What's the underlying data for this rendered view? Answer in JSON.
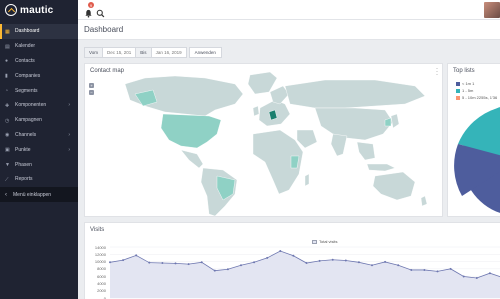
{
  "app": {
    "name": "mautic"
  },
  "header": {
    "notification_count": "9"
  },
  "sidebar": {
    "items": [
      {
        "label": "Dashboard",
        "icon": "dashboard-icon",
        "active": true
      },
      {
        "label": "Kalender",
        "icon": "calendar-icon"
      },
      {
        "label": "Contacts",
        "icon": "user-icon"
      },
      {
        "label": "Companies",
        "icon": "building-icon"
      },
      {
        "label": "Segments",
        "icon": "pie-chart-icon"
      },
      {
        "label": "Komponenten",
        "icon": "puzzle-icon",
        "has_children": true
      },
      {
        "label": "Kampagnen",
        "icon": "clock-icon"
      },
      {
        "label": "Channels",
        "icon": "rss-icon",
        "has_children": true
      },
      {
        "label": "Punkte",
        "icon": "calculator-icon",
        "has_children": true
      },
      {
        "label": "Phasen",
        "icon": "filter-icon"
      },
      {
        "label": "Reports",
        "icon": "line-chart-icon"
      }
    ],
    "collapse_label": "Menü einklappen"
  },
  "page": {
    "title": "Dashboard"
  },
  "date_filter": {
    "from_label": "Vom",
    "from_value": "Dec 15, 201",
    "to_label": "Bis",
    "to_value": "Jan 16, 2019",
    "apply_label": "Anwenden"
  },
  "contact_map": {
    "title": "Contact map",
    "zoom_in": "+",
    "zoom_out": "−",
    "colors": {
      "land": "#c8d8d8",
      "highlight_strong": "#41b9a3",
      "highlight_light": "#8fd1c5",
      "highlight_dark": "#1a7f6e"
    }
  },
  "top_lists": {
    "title": "Top lists",
    "legend": [
      {
        "label": "< 1m 1",
        "color": "#4e5d9d"
      },
      {
        "label": "1 - 5m",
        "color": "#35b4b9"
      },
      {
        "label": "5 - 10m 2255s, 1'36",
        "color": "#fd9572"
      }
    ]
  },
  "visits": {
    "title": "Visits",
    "legend": "Total visits",
    "y_ticks": [
      "14000",
      "12000",
      "10000",
      "8000",
      "6000",
      "4000",
      "2000",
      "0"
    ]
  },
  "chart_data": {
    "type": "line",
    "title": "Visits",
    "series": [
      {
        "name": "Total visits",
        "values": [
          9800,
          10400,
          11700,
          9700,
          9600,
          9500,
          9300,
          9800,
          7500,
          7900,
          9000,
          9800,
          11000,
          12900,
          11600,
          9600,
          10200,
          10500,
          10300,
          9800,
          9000,
          9900,
          9000,
          7700,
          7700,
          7300,
          8000,
          5900,
          5500,
          6800,
          5600
        ]
      }
    ],
    "ylim": [
      0,
      14000
    ],
    "grid": true
  }
}
